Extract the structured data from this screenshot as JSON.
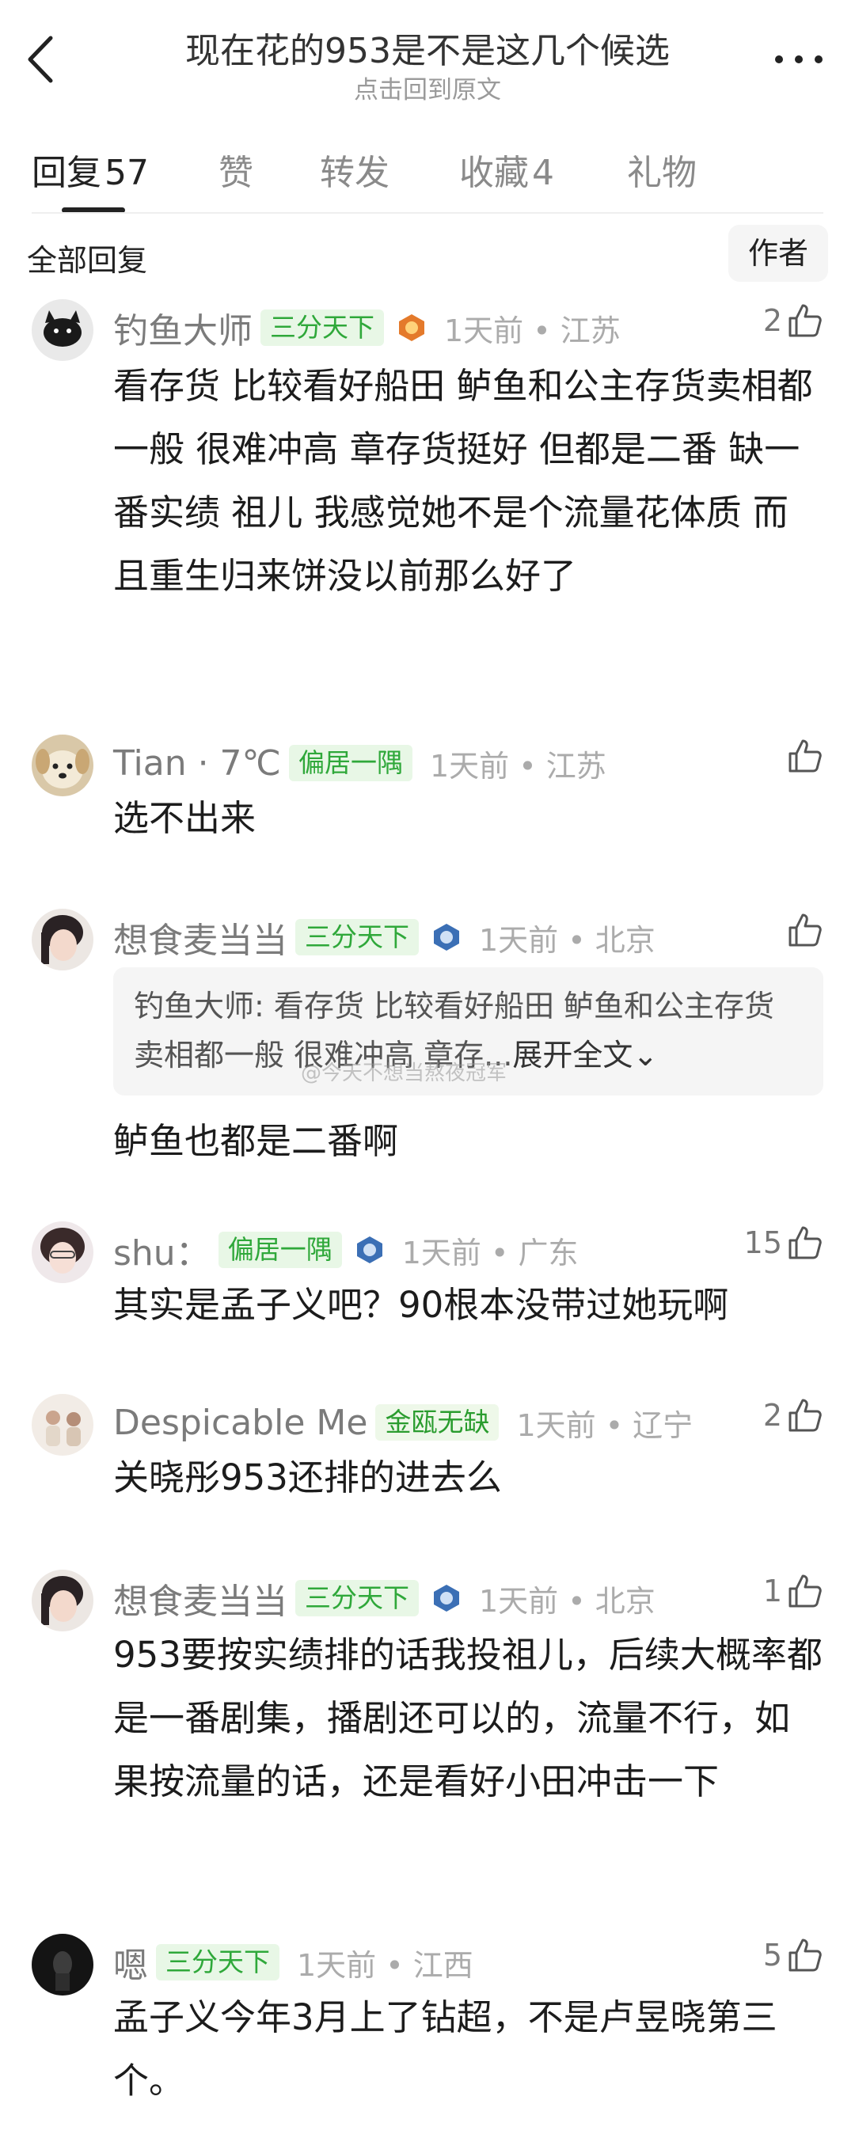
{
  "header": {
    "title": "现在花的953是不是这几个候选",
    "subtitle": "点击回到原文"
  },
  "tabs": [
    {
      "label": "回复",
      "count": "57"
    },
    {
      "label": "赞",
      "count": ""
    },
    {
      "label": "转发",
      "count": ""
    },
    {
      "label": "收藏",
      "count": "4"
    },
    {
      "label": "礼物",
      "count": ""
    }
  ],
  "filter": {
    "all_label": "全部回复",
    "author_label": "作者"
  },
  "comments": [
    {
      "name": "钓鱼大师",
      "badge": "三分天下",
      "time": "1天前 • 江苏",
      "likes": "2",
      "text": "看存货 比较看好船田 鲈鱼和公主存货卖相都一般 很难冲高 章存货挺好 但都是二番 缺一番实绩 祖儿 我感觉她不是个流量花体质 而且重生归来饼没以前那么好了"
    },
    {
      "name": "Tian · 7℃",
      "badge": "偏居一隅",
      "time": "1天前 • 江苏",
      "likes": "",
      "text": "选不出来"
    },
    {
      "name": "想食麦当当",
      "badge": "三分天下",
      "time": "1天前 • 北京",
      "likes": "",
      "quote": "钓鱼大师: 看存货 比较看好船田 鲈鱼和公主存货卖相都一般 很难冲高 章存...",
      "quote_expand": "展开全文",
      "text": "鲈鱼也都是二番啊"
    },
    {
      "name": "shu：",
      "badge": "偏居一隅",
      "time": "1天前 • 广东",
      "likes": "15",
      "text": "其实是孟子义吧？90根本没带过她玩啊"
    },
    {
      "name": "Despicable Me",
      "badge": "金瓯无缺",
      "time": "1天前 • 辽宁",
      "likes": "2",
      "text": "关晓彤953还排的进去么"
    },
    {
      "name": "想食麦当当",
      "badge": "三分天下",
      "time": "1天前 • 北京",
      "likes": "1",
      "text": "953要按实绩排的话我投祖儿，后续大概率都是一番剧集，播剧还可以的，流量不行，如果按流量的话，还是看好小田冲击一下"
    },
    {
      "name": "嗯",
      "badge": "三分天下",
      "time": "1天前 • 江西",
      "likes": "5",
      "text": "孟子义今年3月上了钻超，不是卢昱晓第三个。"
    }
  ],
  "watermark": "@今天不想当熬夜冠军"
}
